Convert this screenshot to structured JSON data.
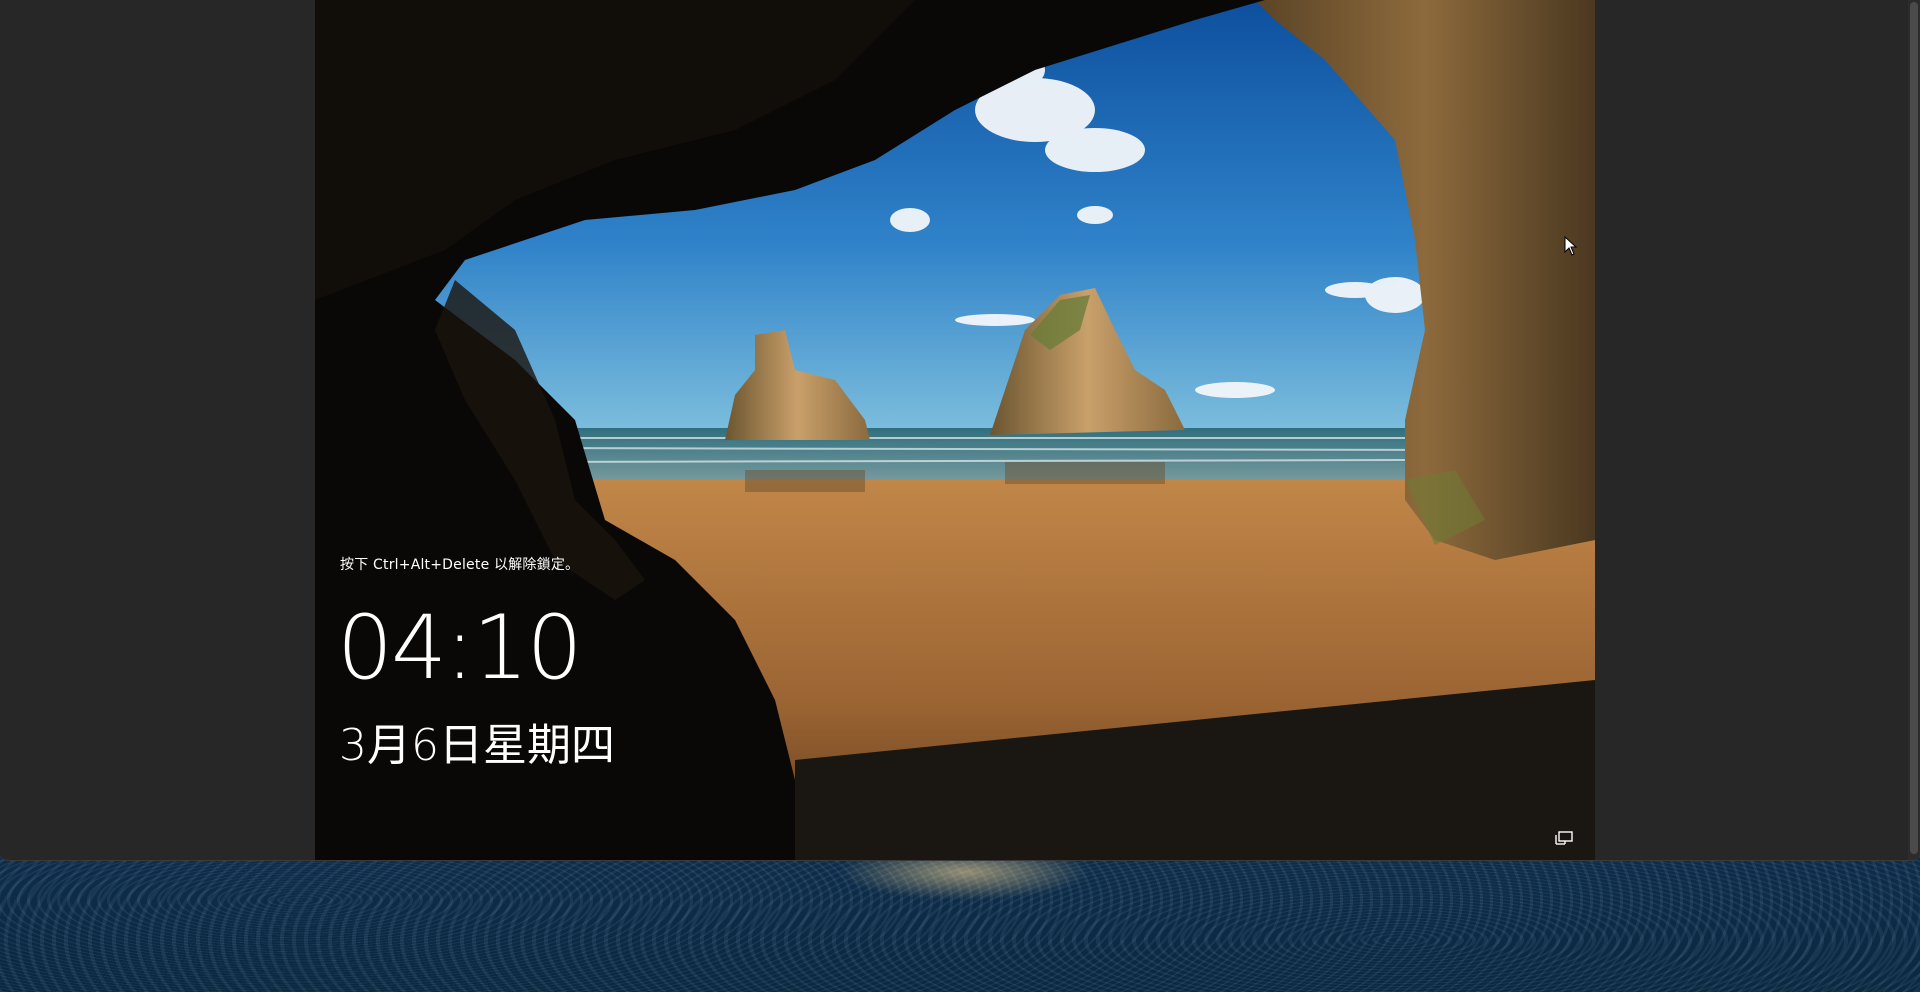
{
  "lock_screen": {
    "hint": "按下 Ctrl+Alt+Delete 以解除鎖定。",
    "time": "04:10",
    "date": "3月6日星期四"
  },
  "icons": {
    "network": "network-icon",
    "cursor": "mouse-cursor-icon"
  },
  "colors": {
    "viewer_background": "#272727",
    "lock_text": "#ffffff",
    "sky": "#2f7cc4",
    "sand": "#b5773a",
    "water_desktop": "#1d4f86"
  }
}
